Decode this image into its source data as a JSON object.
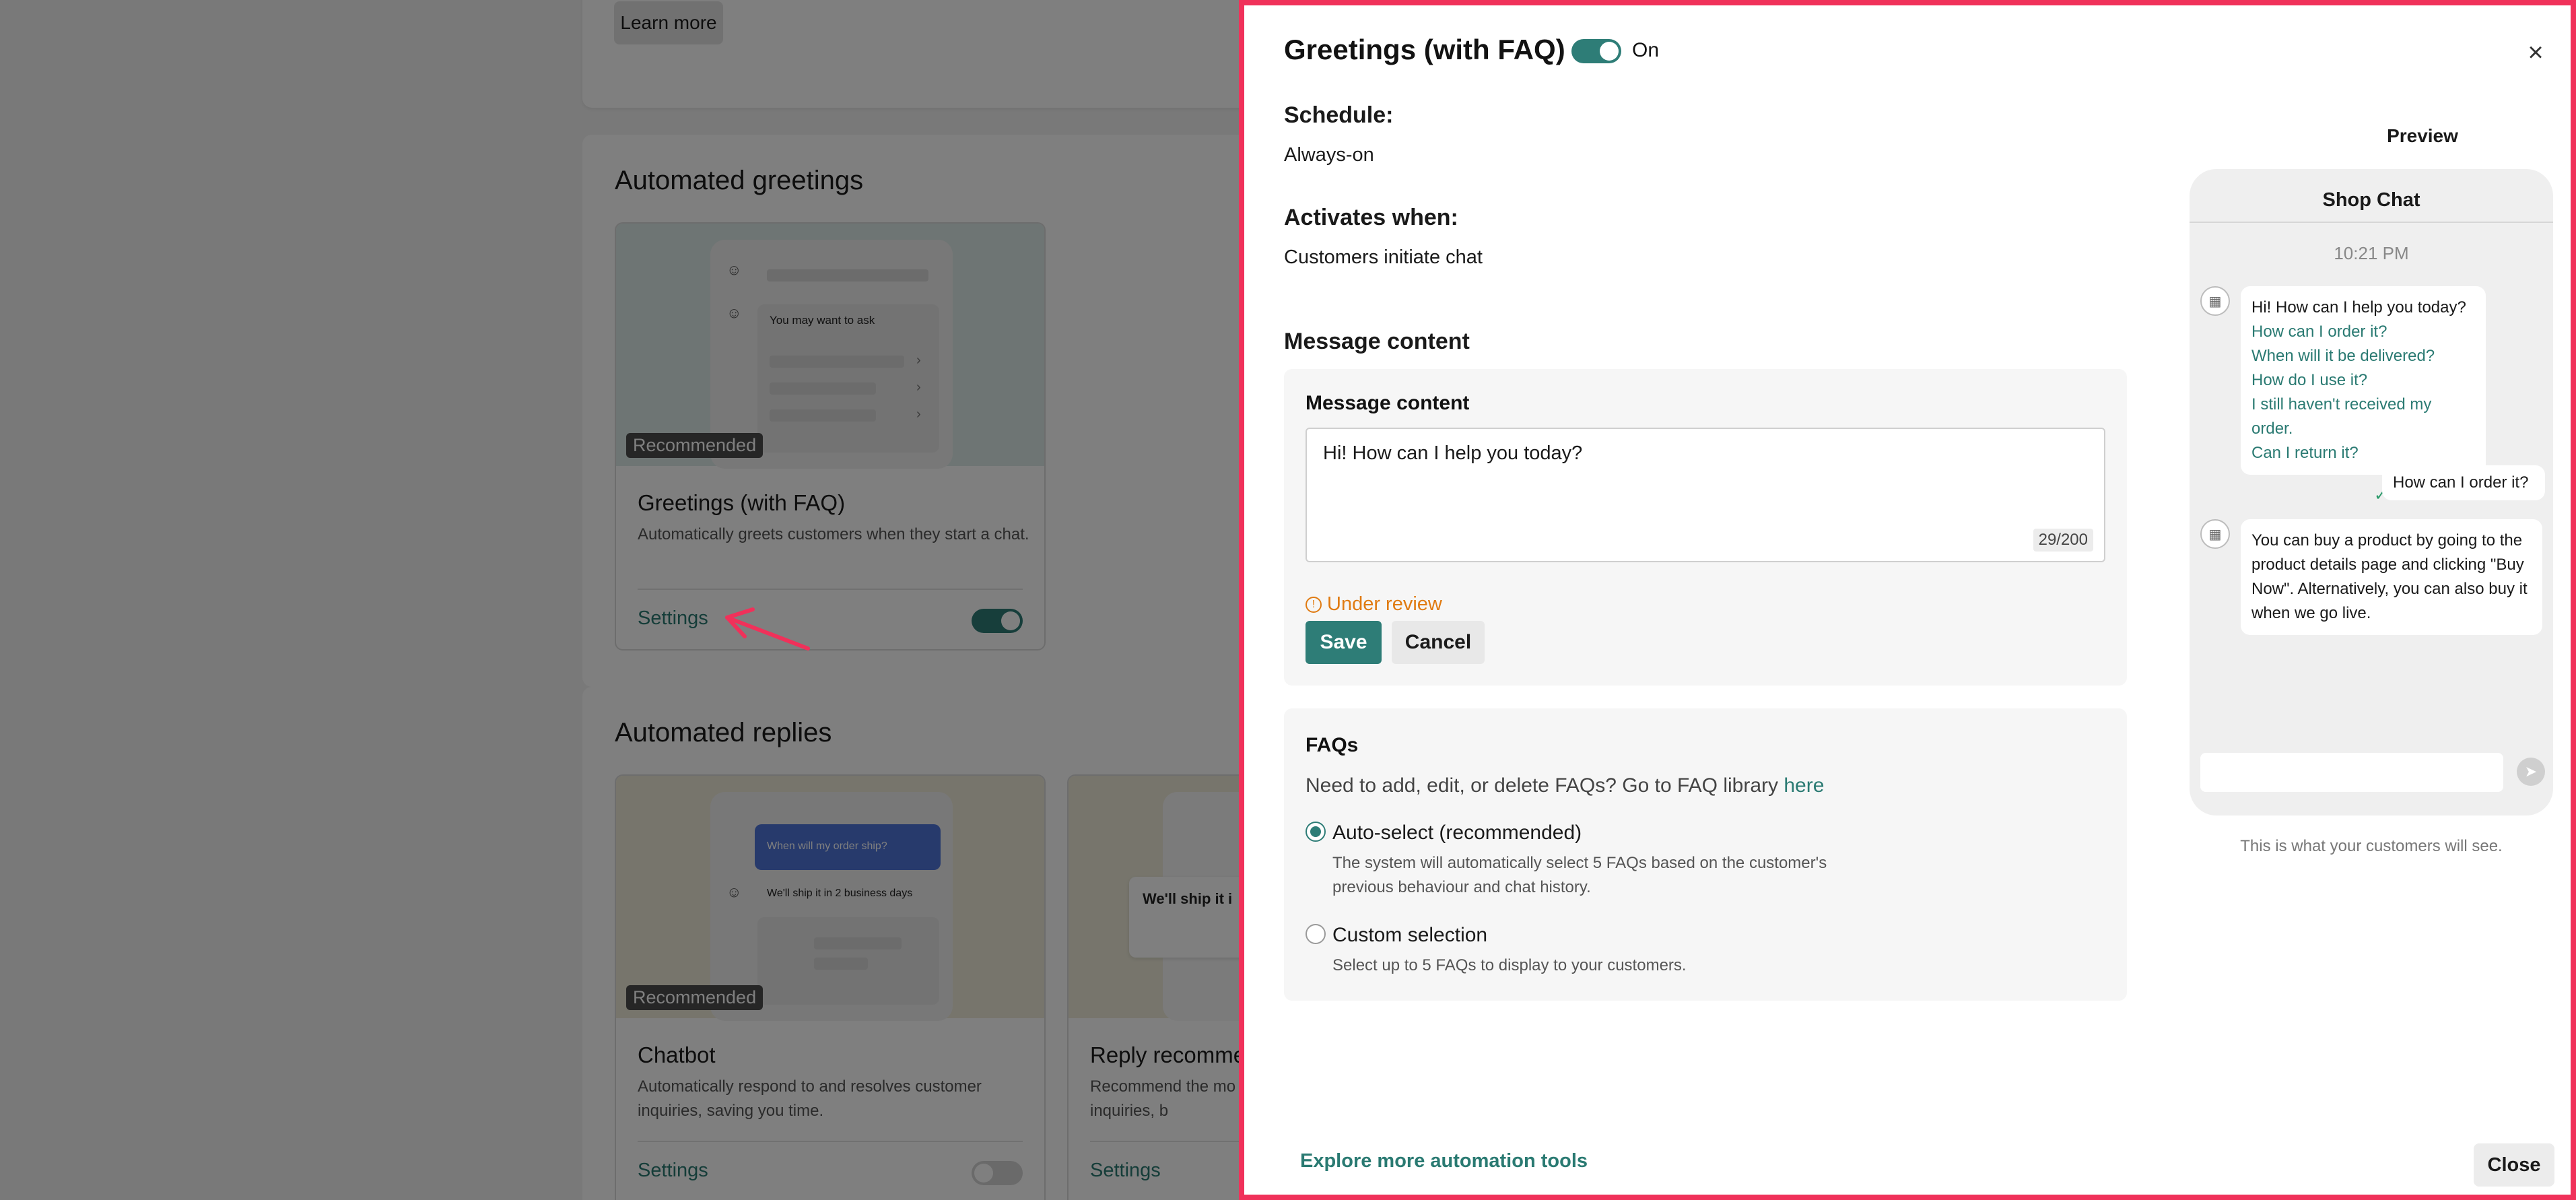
{
  "background": {
    "learn_more": "Learn more",
    "greetings_section": {
      "heading": "Automated greetings",
      "card": {
        "illus_label": "You may want to ask",
        "badge": "Recommended",
        "title": "Greetings (with FAQ)",
        "description": "Automatically greets customers when they start a chat.",
        "settings": "Settings",
        "toggle_on": true
      }
    },
    "replies_section": {
      "heading": "Automated replies",
      "cards": [
        {
          "illus_question": "When will my order ship?",
          "illus_answer": "We'll ship it in 2 business days",
          "badge": "Recommended",
          "title": "Chatbot",
          "description": "Automatically respond to and resolves customer inquiries, saving you time.",
          "settings": "Settings",
          "toggle_on": false
        },
        {
          "illus_answer": "We'll ship it i",
          "title": "Reply recomme",
          "description": "Recommend the mo customer inquiries, b",
          "settings": "Settings"
        }
      ]
    }
  },
  "drawer": {
    "title": "Greetings (with FAQ)",
    "toggle_label": "On",
    "close_icon": "×",
    "schedule_label": "Schedule:",
    "schedule_value": "Always-on",
    "activates_label": "Activates when:",
    "activates_value": "Customers initiate chat",
    "message_section_title": "Message content",
    "message_box": {
      "title": "Message content",
      "text": "Hi! How can I help you today?",
      "counter": "29/200",
      "status": "Under review",
      "save": "Save",
      "cancel": "Cancel"
    },
    "faq": {
      "title": "FAQs",
      "help_text": "Need to add, edit, or delete FAQs? Go to FAQ library ",
      "help_link": "here",
      "options": [
        {
          "label": "Auto-select (recommended)",
          "description": "The system will automatically select 5 FAQs based on the customer's previous behaviour and chat history.",
          "checked": true
        },
        {
          "label": "Custom selection",
          "description": "Select up to 5 FAQs to display to your customers.",
          "checked": false
        }
      ]
    },
    "explore_link": "Explore more automation tools",
    "close_button": "Close"
  },
  "preview": {
    "label": "Preview",
    "chat_title": "Shop Chat",
    "time": "10:21 PM",
    "bot_greeting": "Hi! How can I help you today?",
    "faq_links": [
      "How can I order it?",
      "When will it be delivered?",
      "How do I use it?",
      "I still haven't received my order.",
      "Can I return it?"
    ],
    "user_message": "How can I order it?",
    "bot_reply": "You can buy a product by going to the product details page and clicking \"Buy Now\". Alternatively, you can also buy it when we go live.",
    "note": "This is what your customers will see."
  },
  "colors": {
    "accent": "#2e7d77",
    "drawer_border": "#f0315a",
    "warning": "#e07b12"
  }
}
